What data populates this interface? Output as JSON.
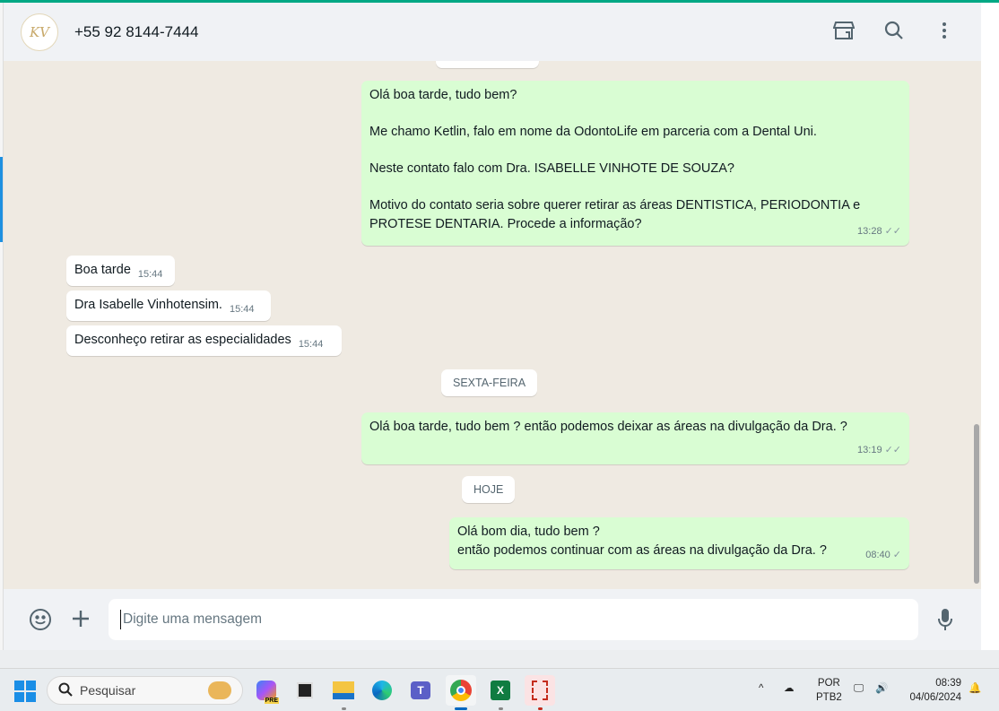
{
  "header": {
    "avatar_initials": "KV",
    "contact": "+55 92 8144-7444"
  },
  "messages": [
    {
      "dir": "out",
      "lines": [
        "Olá boa tarde, tudo bem?",
        "",
        "Me chamo Ketlin, falo em nome da OdontoLife em parceria com a Dental Uni.",
        "",
        "Neste contato falo com Dra. ISABELLE VINHOTE DE SOUZA?",
        "",
        "Motivo do contato seria sobre querer retirar as áreas DENTISTICA, PERIODONTIA e",
        "PROTESE DENTARIA. Procede a informação?"
      ],
      "time": "13:28",
      "status": "read"
    },
    {
      "dir": "in",
      "text": "Boa tarde",
      "time": "15:44"
    },
    {
      "dir": "in",
      "text": "Dra Isabelle Vinhotensim.",
      "time": "15:44"
    },
    {
      "dir": "in",
      "text": "Desconheço retirar as especialidades",
      "time": "15:44"
    },
    {
      "dir": "out",
      "text": "Olá boa tarde, tudo bem ? então podemos deixar as áreas na divulgação da Dra. ?",
      "time": "13:19",
      "status": "read"
    },
    {
      "dir": "out",
      "lines": [
        "Olá bom dia, tudo bem ?",
        "então podemos continuar com as áreas na divulgação da Dra. ?"
      ],
      "time": "08:40",
      "status": "sent"
    }
  ],
  "dates": {
    "d1": "SEXTA-FEIRA",
    "d2": "HOJE"
  },
  "composer": {
    "placeholder": "Digite uma mensagem"
  },
  "taskbar": {
    "search": "Pesquisar",
    "lang1": "POR",
    "lang2": "PTB2",
    "time": "08:39",
    "date": "04/06/2024",
    "copilot_badge": "PRE"
  }
}
